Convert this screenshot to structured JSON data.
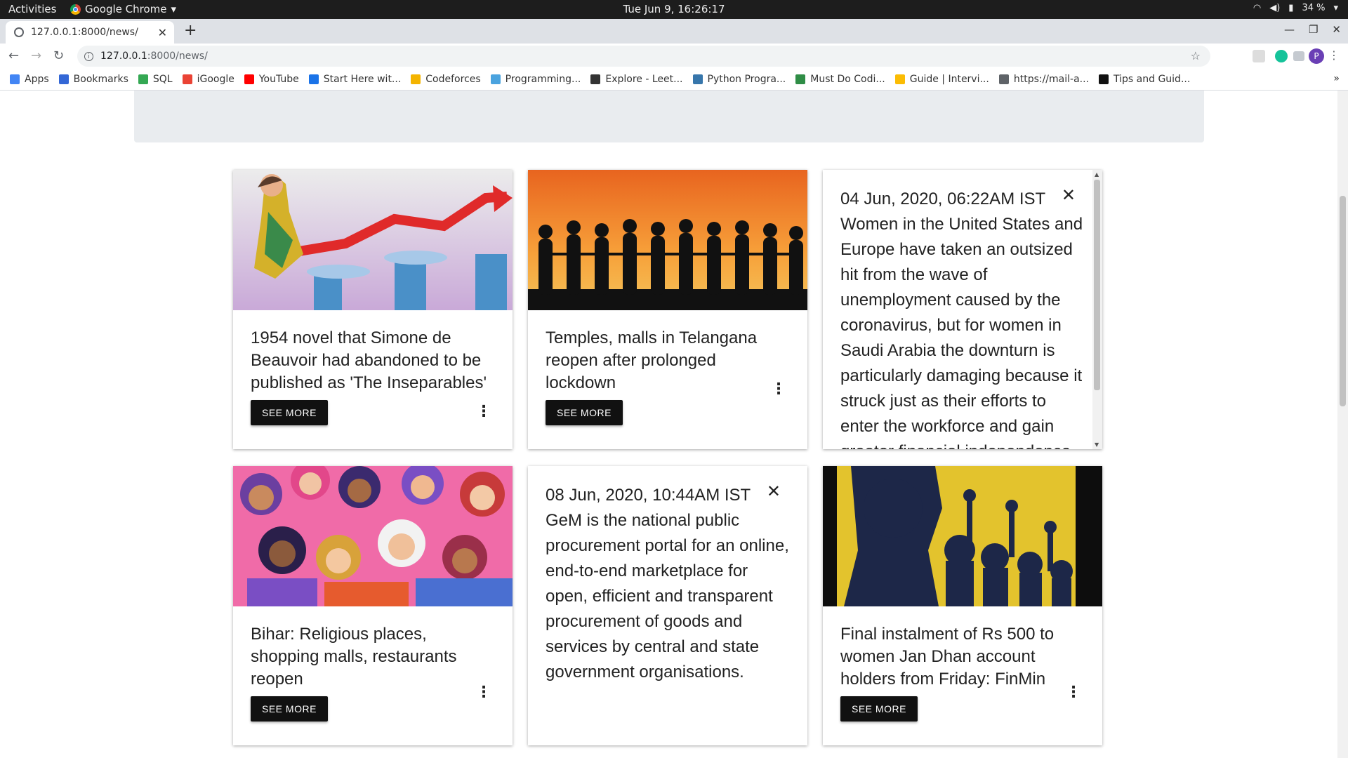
{
  "system_bar": {
    "activities": "Activities",
    "app_name": "Google Chrome",
    "clock": "Tue Jun  9, 16:26:17",
    "battery": "34 %"
  },
  "browser": {
    "tab_title": "127.0.0.1:8000/news/",
    "url_host": "127.0.0.1",
    "url_path": ":8000/news/",
    "profile_initial": "P",
    "bookmarks": [
      {
        "label": "Apps",
        "icon": "apps-grid-icon",
        "color": "#4285f4"
      },
      {
        "label": "Bookmarks",
        "icon": "star-icon",
        "color": "#3367d6"
      },
      {
        "label": "SQL",
        "icon": "sql-icon",
        "color": "#34a853"
      },
      {
        "label": "iGoogle",
        "icon": "google-icon",
        "color": "#ea4335"
      },
      {
        "label": "YouTube",
        "icon": "youtube-icon",
        "color": "#ff0000"
      },
      {
        "label": "Start Here wit...",
        "icon": "blue-circle-icon",
        "color": "#1a73e8"
      },
      {
        "label": "Codeforces",
        "icon": "codeforces-icon",
        "color": "#f4b400"
      },
      {
        "label": "Programming...",
        "icon": "ib-icon",
        "color": "#4aa3df"
      },
      {
        "label": "Explore - Leet...",
        "icon": "leetcode-icon",
        "color": "#333333"
      },
      {
        "label": "Python Progra...",
        "icon": "python-icon",
        "color": "#3776ab"
      },
      {
        "label": "Must Do Codi...",
        "icon": "gfg-icon",
        "color": "#2f8d46"
      },
      {
        "label": "Guide | Intervi...",
        "icon": "guide-icon",
        "color": "#fbbc04"
      },
      {
        "label": "https://mail-a...",
        "icon": "globe-icon",
        "color": "#5f6368"
      },
      {
        "label": "Tips and Guid...",
        "icon": "hackerrank-icon",
        "color": "#111111"
      }
    ]
  },
  "cards": [
    {
      "headline": "1954 novel that Simone de Beauvoir had abandoned to be published as 'The Inseparables'",
      "button": "SEE MORE"
    },
    {
      "headline": "Temples, malls in Telangana reopen after prolonged lockdown",
      "button": "SEE MORE"
    },
    {
      "date": "04 Jun, 2020, 06:22AM IST",
      "summary": "Women in the United States and Europe have taken an outsized hit from the wave of unemployment caused by the coronavirus, but for women in Saudi Arabia the downturn is particularly damaging because it struck just as their efforts to enter the workforce and gain greater financial independence"
    },
    {
      "headline": "Bihar: Religious places, shopping malls, restaurants reopen",
      "button": "SEE MORE"
    },
    {
      "date": "08 Jun, 2020, 10:44AM IST",
      "summary": "GeM is the national public procurement portal for an online, end-to-end marketplace for open, efficient and transparent procurement of goods and services by central and state government organisations."
    },
    {
      "headline": "Final instalment of Rs 500 to women Jan Dhan account holders from Friday: FinMin",
      "button": "SEE MORE"
    }
  ]
}
